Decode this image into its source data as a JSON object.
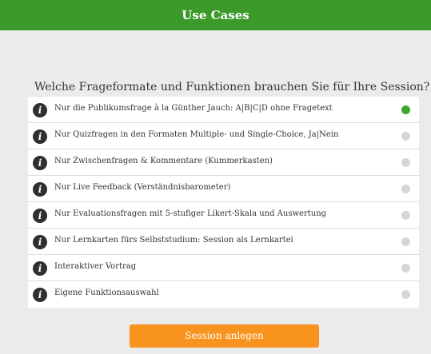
{
  "header": {
    "title": "Use Cases"
  },
  "question": "Welche Frageformate und Funktionen brauchen Sie für Ihre Session?",
  "options": [
    {
      "label": "Nur die Publikumsfrage à la Günther Jauch: A|B|C|D ohne Fragetext",
      "selected": true
    },
    {
      "label": "Nur Quizfragen in den Formaten Multiple- und Single-Choice, Ja|Nein",
      "selected": false
    },
    {
      "label": "Nur Zwischenfragen & Kommentare (Kummerkasten)",
      "selected": false
    },
    {
      "label": "Nur Live Feedback (Verständnisbarometer)",
      "selected": false
    },
    {
      "label": "Nur Evaluationsfragen mit 5-stufiger Likert-Skala und Auswertung",
      "selected": false
    },
    {
      "label": "Nur Lernkarten fürs Selbststudium: Session als Lernkartei",
      "selected": false
    },
    {
      "label": "Interaktiver Vortrag",
      "selected": false
    },
    {
      "label": "Eigene Funktionsauswahl",
      "selected": false
    }
  ],
  "info_glyph": "i",
  "icons": {
    "info": "info-icon"
  },
  "colors": {
    "header": "#3c9a2a",
    "selected": "#3fa52f",
    "button": "#f7931e"
  },
  "create_button": "Session anlegen"
}
